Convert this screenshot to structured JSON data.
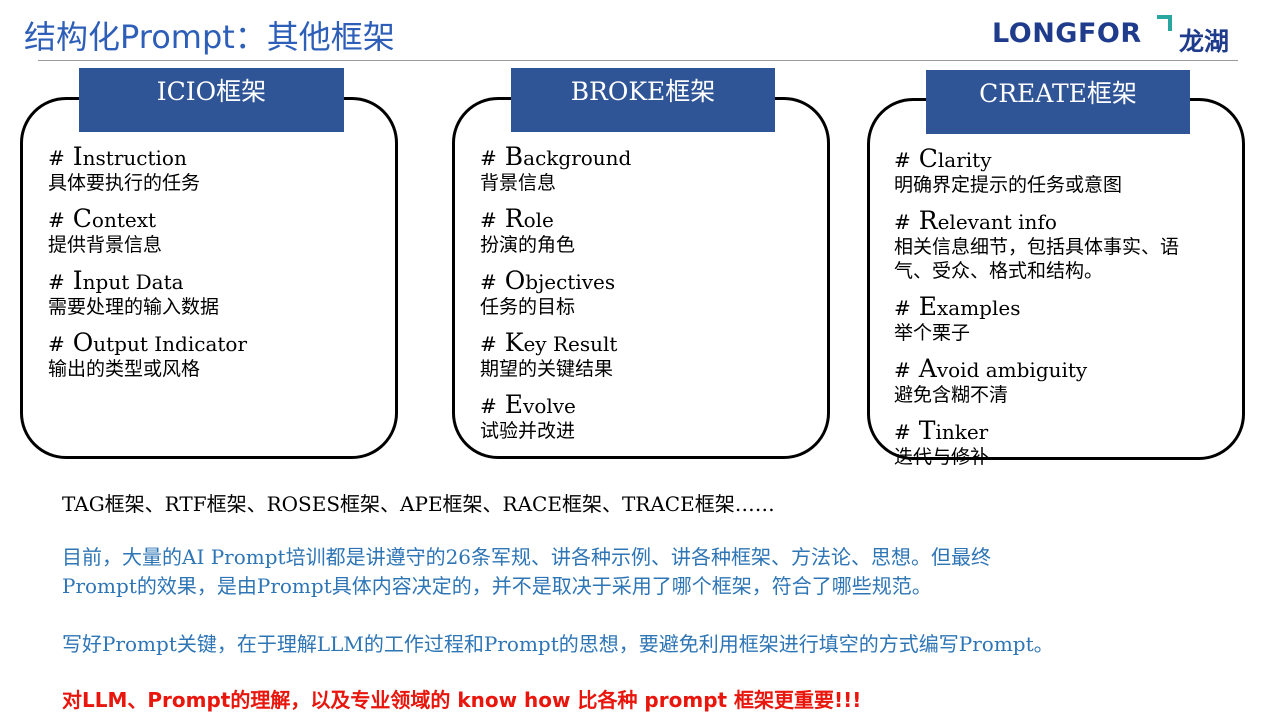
{
  "slide": {
    "title": "结构化Prompt：其他框架",
    "logo_word": "LONGFOR",
    "logo_cn": "龙湖"
  },
  "frameworks": [
    {
      "label": "ICIO框架",
      "items": [
        {
          "hash": "#",
          "cap": "I",
          "rest": "nstruction",
          "desc": "具体要执行的任务"
        },
        {
          "hash": "#",
          "cap": "C",
          "rest": "ontext",
          "desc": "提供背景信息"
        },
        {
          "hash": "#",
          "cap": "I",
          "rest": "nput Data",
          "desc": "需要处理的输入数据"
        },
        {
          "hash": "#",
          "cap": "O",
          "rest": "utput Indicator",
          "desc": "输出的类型或风格"
        }
      ]
    },
    {
      "label": "BROKE框架",
      "items": [
        {
          "hash": "#",
          "cap": "B",
          "rest": "ackground",
          "desc": "背景信息"
        },
        {
          "hash": "#",
          "cap": "R",
          "rest": "ole",
          "desc": "扮演的角色"
        },
        {
          "hash": "#",
          "cap": "O",
          "rest": "bjectives",
          "desc": "任务的目标"
        },
        {
          "hash": "#",
          "cap": "K",
          "rest": "ey Result",
          "desc": "期望的关键结果"
        },
        {
          "hash": "#",
          "cap": "E",
          "rest": "volve",
          "desc": "试验并改进"
        }
      ]
    },
    {
      "label": "CREATE框架",
      "items": [
        {
          "hash": "#",
          "cap": "C",
          "rest": "larity",
          "desc": "明确界定提示的任务或意图"
        },
        {
          "hash": "#",
          "cap": "R",
          "rest": "elevant info",
          "desc": "相关信息细节，包括具体事实、语",
          "desc2": "气、受众、格式和结构。"
        },
        {
          "hash": "#",
          "cap": "E",
          "rest": "xamples",
          "desc": "举个栗子"
        },
        {
          "hash": "#",
          "cap": "A",
          "rest": "void ambiguity",
          "desc": "避免含糊不清"
        },
        {
          "hash": "#",
          "cap": "T",
          "rest": "inker",
          "desc": "迭代与修补"
        }
      ]
    }
  ],
  "notes": {
    "others": "TAG框架、RTF框架、ROSES框架、APE框架、RACE框架、TRACE框架……",
    "blue_line1": "目前，大量的AI Prompt培训都是讲遵守的26条军规、讲各种示例、讲各种框架、方法论、思想。但最终",
    "blue_line2": "Prompt的效果，是由Prompt具体内容决定的，并不是取决于采用了哪个框架，符合了哪些规范。",
    "blue_line3": "写好Prompt关键，在于理解LLM的工作过程和Prompt的思想，要避免利用框架进行填空的方式编写Prompt。",
    "red_line": "对LLM、Prompt的理解，以及专业领域的 know how 比各种 prompt 框架更重要!!!"
  },
  "colors": {
    "title_blue": "#2e5fb8",
    "header_fill": "#2f5597",
    "note_blue": "#2e75b6",
    "emphasis_red": "#e8160c",
    "logo_navy": "#1e3b8c",
    "logo_accent": "#2aa6a0"
  }
}
